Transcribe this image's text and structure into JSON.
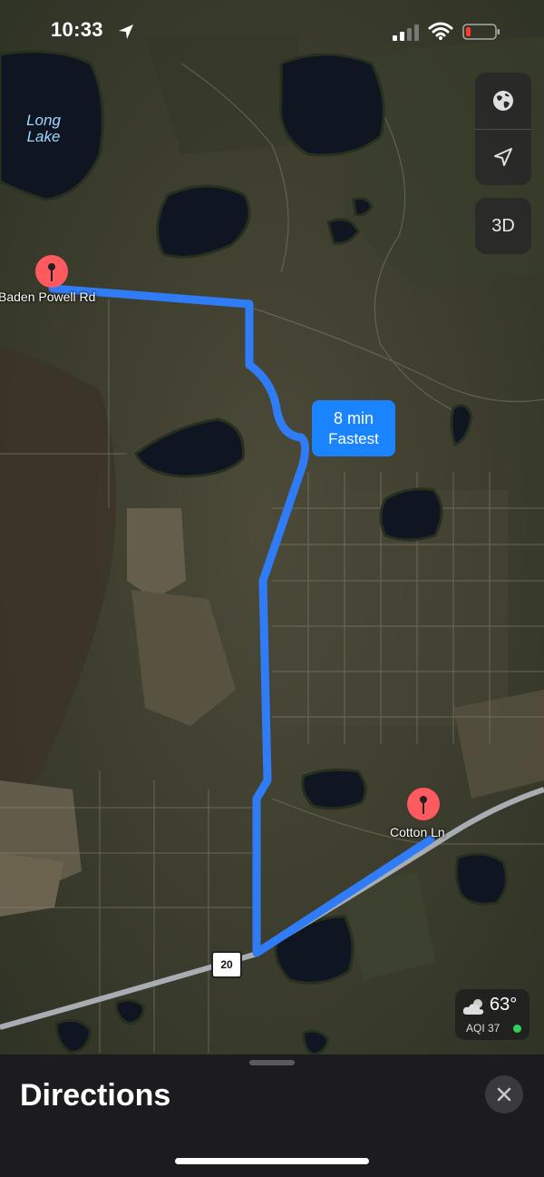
{
  "status_bar": {
    "time": "10:33",
    "battery_color": "#ff3b30"
  },
  "map_controls": {
    "globe_icon": "globe-icon",
    "location_icon": "location-arrow-icon",
    "view_3d_label": "3D"
  },
  "map": {
    "lake_label": "Long Lake",
    "start_label": "Baden Powell Rd",
    "end_label": "Cotton Ln",
    "road_shield": "20",
    "route_time": "8 min",
    "route_type": "Fastest",
    "route_color": "#2f7cf6",
    "pin_color": "#ff5a5f"
  },
  "weather": {
    "temperature": "63°",
    "aqi": "AQI 37",
    "aqi_color": "#30d158",
    "icon": "partly-cloudy-icon"
  },
  "sheet": {
    "title": "Directions",
    "close_icon": "close-icon"
  }
}
